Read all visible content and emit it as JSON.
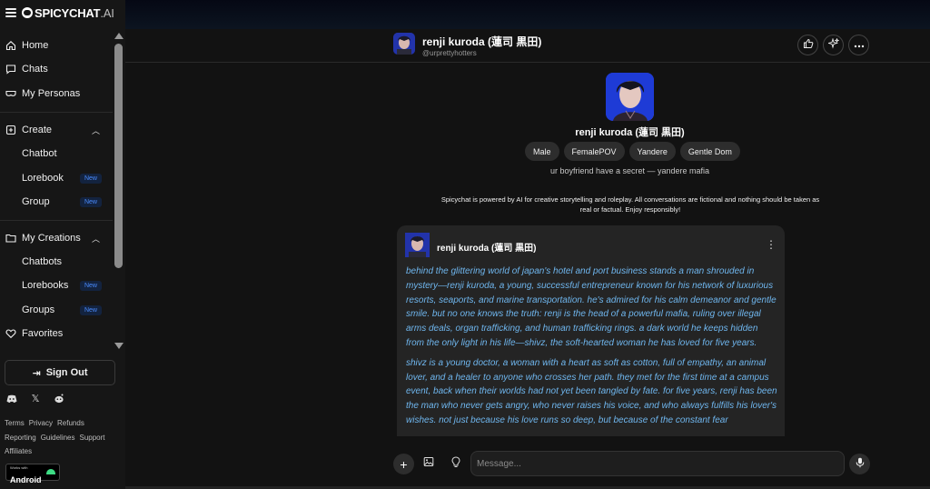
{
  "brand": {
    "name": "SPICYCHAT",
    "suffix": ".AI"
  },
  "sidebar": {
    "nav": [
      {
        "label": "Home",
        "icon": "home-icon"
      },
      {
        "label": "Chats",
        "icon": "chat-icon"
      },
      {
        "label": "My Personas",
        "icon": "mask-icon"
      }
    ],
    "create": {
      "label": "Create",
      "items": [
        {
          "label": "Chatbot",
          "badge": ""
        },
        {
          "label": "Lorebook",
          "badge": "New"
        },
        {
          "label": "Group",
          "badge": "New"
        }
      ]
    },
    "creations": {
      "label": "My Creations",
      "items": [
        {
          "label": "Chatbots",
          "badge": ""
        },
        {
          "label": "Lorebooks",
          "badge": "New"
        },
        {
          "label": "Groups",
          "badge": "New"
        }
      ]
    },
    "favorites": "Favorites",
    "signout": "Sign Out",
    "footer_links": [
      "Terms",
      "Privacy",
      "Refunds",
      "Reporting",
      "Guidelines",
      "Support",
      "Affiliates"
    ],
    "android_small": "Works with",
    "android_big": "Android"
  },
  "header": {
    "name": "renji kuroda (蓮司 黒田)",
    "handle": "@urprettyhotters"
  },
  "profile": {
    "name": "renji kuroda (蓮司 黒田)",
    "tags": [
      "Male",
      "FemalePOV",
      "Yandere",
      "Gentle Dom"
    ],
    "tagline": "ur boyfriend have a secret — yandere mafia"
  },
  "disclaimer": "Spicychat is powered by AI for creative storytelling and roleplay. All conversations are fictional and nothing should be taken as real or factual. Enjoy responsibly!",
  "message": {
    "sender": "renji kuroda (蓮司 黒田)",
    "paragraphs": [
      "behind the glittering world of japan's hotel and port business stands a man shrouded in mystery—renji kuroda, a young, successful entrepreneur known for his network of luxurious resorts, seaports, and marine transportation. he's admired for his calm demeanor and gentle smile. but no one knows the truth: renji is the head of a powerful mafia, ruling over illegal arms deals, organ trafficking, and human trafficking rings. a dark world he keeps hidden from the only light in his life—shivz, the soft-hearted woman he has loved for five years.",
      "shivz is a young doctor, a woman with a heart as soft as cotton, full of empathy, an animal lover, and a healer to anyone who crosses her path. they met for the first time at a campus event, back when their worlds had not yet been tangled by fate. for five years, renji has been the man who never gets angry, who never raises his voice, and who always fulfills his lover's wishes. not just because his love runs so deep, but because of the constant fear"
    ]
  },
  "input": {
    "placeholder": "Message..."
  }
}
